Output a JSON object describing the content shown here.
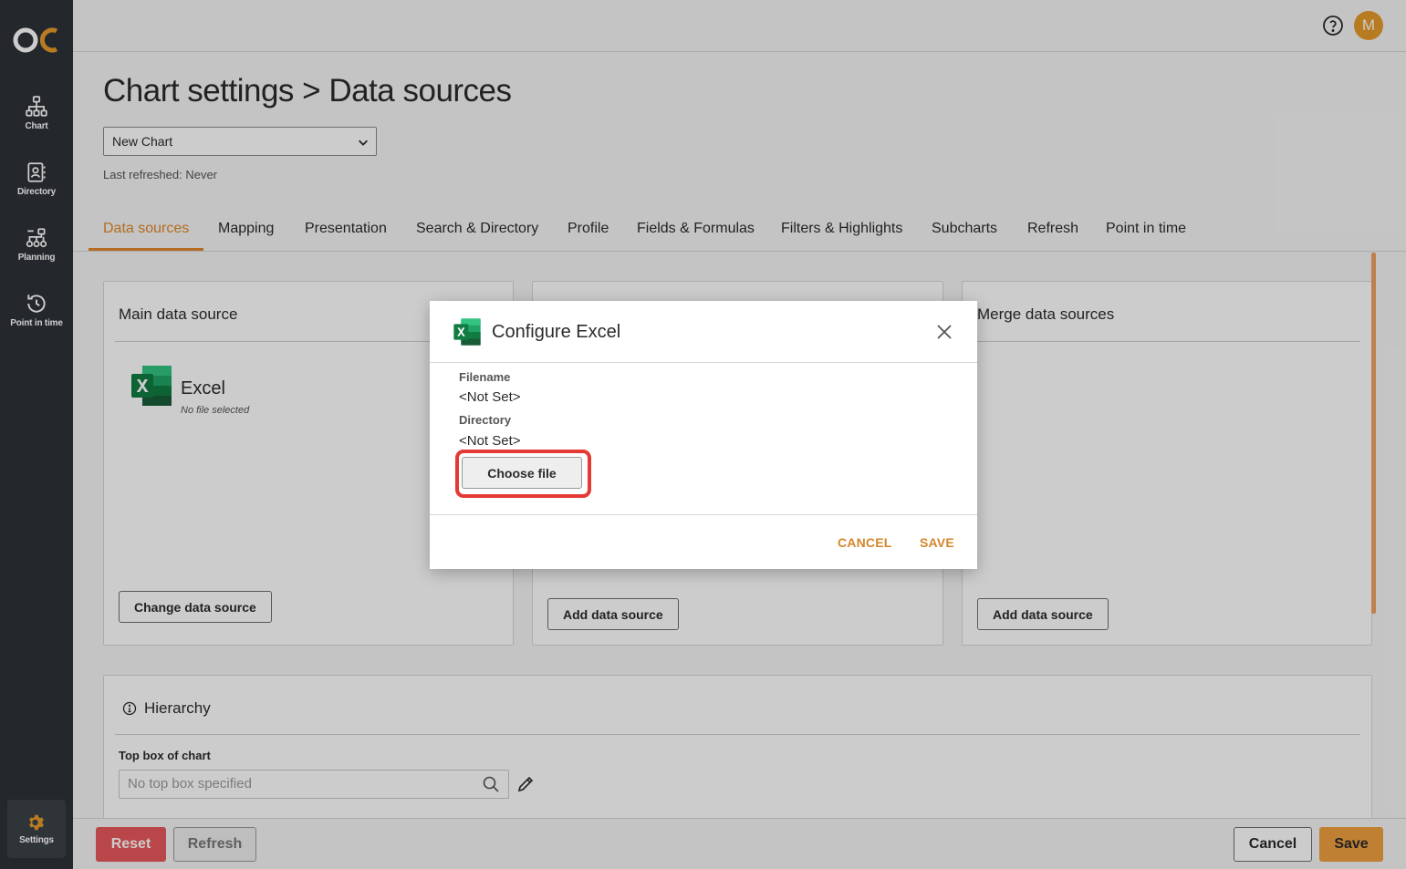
{
  "sidebar": {
    "logo": "oc-logo",
    "items": [
      {
        "label": "Chart",
        "icon": "org-chart-icon"
      },
      {
        "label": "Directory",
        "icon": "directory-icon"
      },
      {
        "label": "Planning",
        "icon": "planning-icon"
      },
      {
        "label": "Point in time",
        "icon": "history-icon"
      }
    ],
    "settings": {
      "label": "Settings",
      "icon": "gear-icon"
    }
  },
  "topbar": {
    "avatar_initial": "M",
    "help_icon": "help-icon"
  },
  "header": {
    "title": "Chart settings > Data sources",
    "chart_select_value": "New Chart",
    "last_refreshed": "Last refreshed: Never"
  },
  "tabs": [
    {
      "label": "Data sources",
      "active": true
    },
    {
      "label": "Mapping"
    },
    {
      "label": "Presentation"
    },
    {
      "label": "Search & Directory"
    },
    {
      "label": "Profile"
    },
    {
      "label": "Fields & Formulas"
    },
    {
      "label": "Filters & Highlights"
    },
    {
      "label": "Subcharts"
    },
    {
      "label": "Refresh"
    },
    {
      "label": "Point in time"
    }
  ],
  "panels": {
    "main": {
      "title": "Main data source",
      "source_name": "Excel",
      "source_sub": "No file selected",
      "button": "Change data source"
    },
    "secondary": {
      "button": "Add data source"
    },
    "merge": {
      "title": "Merge data sources",
      "button": "Add data source"
    }
  },
  "hierarchy": {
    "title": "Hierarchy",
    "top_box_label": "Top box of chart",
    "top_box_placeholder": "No top box specified"
  },
  "bottombar": {
    "reset": "Reset",
    "refresh": "Refresh",
    "cancel": "Cancel",
    "save": "Save"
  },
  "modal": {
    "title": "Configure Excel",
    "filename_label": "Filename",
    "filename_value": "<Not Set>",
    "directory_label": "Directory",
    "directory_value": "<Not Set>",
    "choose_file": "Choose file",
    "cancel": "CANCEL",
    "save": "SAVE"
  },
  "colors": {
    "accent": "#e0882a",
    "sidebar": "#2d3238",
    "danger": "#e8585a",
    "highlight": "#e53935"
  }
}
